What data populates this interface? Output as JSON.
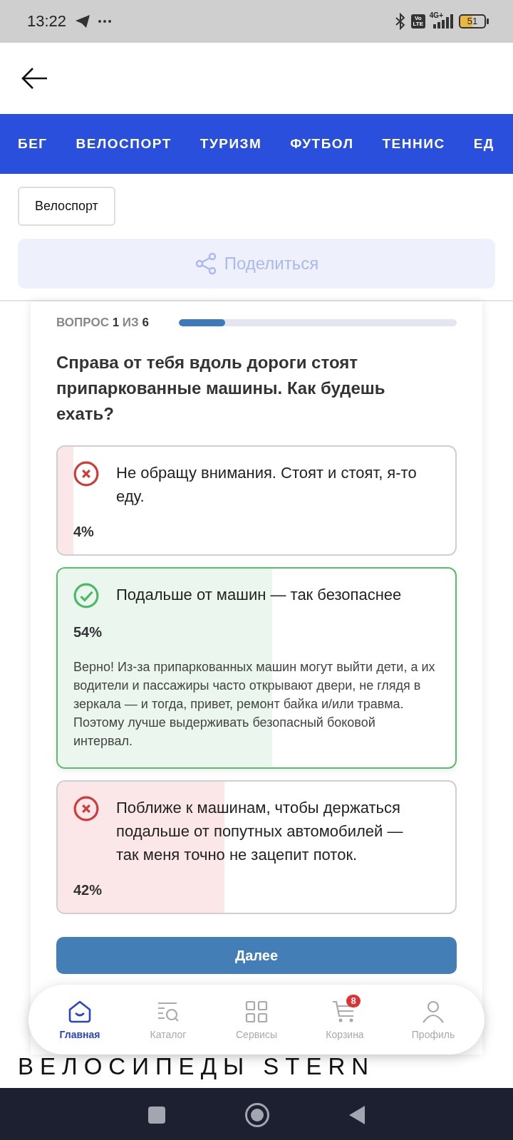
{
  "status_bar": {
    "time": "13:22",
    "volte": "Vo LTE",
    "network": "4G+",
    "battery": "51"
  },
  "sport_tabs": [
    {
      "label": "БЕГ"
    },
    {
      "label": "ВЕЛОСПОРТ"
    },
    {
      "label": "ТУРИЗМ"
    },
    {
      "label": "ФУТБОЛ"
    },
    {
      "label": "ТЕННИС"
    },
    {
      "label": "ЕД"
    }
  ],
  "tag": "Велоспорт",
  "share_button": {
    "label": "Поделиться",
    "disabled": true
  },
  "quiz": {
    "counter": "ВОПРОС **1** ИЗ **6**",
    "progress": {
      "level": 0.167
    },
    "question": "Справа от тебя вдоль дороги стоят припаркованные машины. Как будешь ехать?",
    "options": [
      {
        "kind": "wrong",
        "text": "Не обращу внимания. Стоят и стоят, я-то еду.",
        "percent": "4%",
        "level": 0.04
      },
      {
        "kind": "correct",
        "text": "Подальше от машин — так безопаснее",
        "percent": "54%",
        "level": 0.54,
        "explanation": "Верно! Из-за припаркованных машин могут выйти дети, а их водители и пассажиры часто открывают двери, не глядя в зеркала — и тогда, привет, ремонт байка и/или травма. Поэтому лучше выдерживать безопасный боковой интервал."
      },
      {
        "kind": "wrong",
        "text": "Поближе к машинам, чтобы держаться подальше от попутных автомобилей — так меня точно не зацепит поток.",
        "percent": "42%",
        "level": 0.42
      }
    ],
    "next_button": "Далее"
  },
  "bottom_nav": [
    {
      "label": "Главная",
      "selected": true
    },
    {
      "label": "Каталог",
      "selected": false
    },
    {
      "label": "Сервисы",
      "selected": false
    },
    {
      "label": "Корзина",
      "selected": false,
      "badge": "8"
    },
    {
      "label": "Профиль",
      "selected": false
    }
  ],
  "brand_text": "ВЕЛОСИПЕДЫ STERN"
}
